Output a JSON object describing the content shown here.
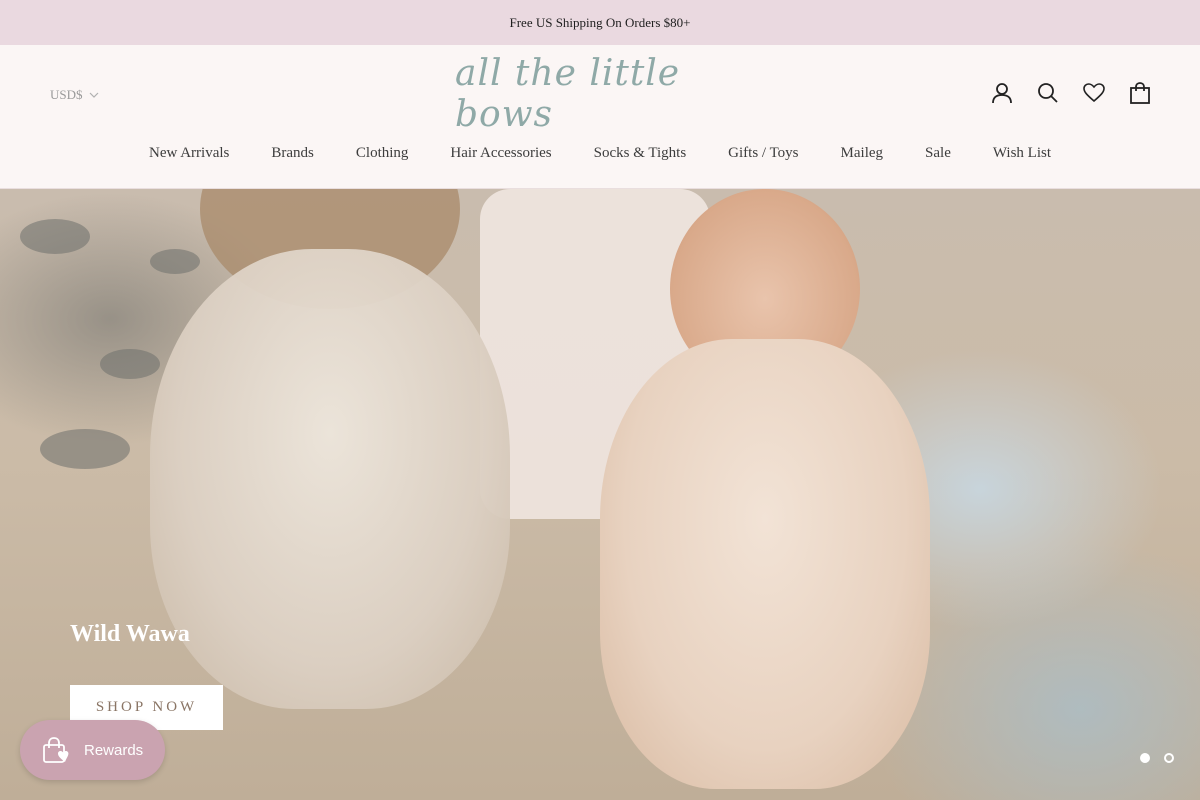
{
  "announcement": "Free US Shipping On Orders $80+",
  "header": {
    "currency": "USD$",
    "logo_text": "all the little bows",
    "icons": [
      "account-icon",
      "search-icon",
      "heart-icon",
      "bag-icon"
    ]
  },
  "nav": {
    "items": [
      {
        "label": "New Arrivals"
      },
      {
        "label": "Brands"
      },
      {
        "label": "Clothing"
      },
      {
        "label": "Hair Accessories"
      },
      {
        "label": "Socks & Tights"
      },
      {
        "label": "Gifts / Toys"
      },
      {
        "label": "Maileg"
      },
      {
        "label": "Sale"
      },
      {
        "label": "Wish List"
      }
    ]
  },
  "hero": {
    "title": "Wild Wawa",
    "button": "SHOP NOW",
    "slides_total": 2,
    "active_slide": 1
  },
  "rewards": {
    "label": "Rewards"
  },
  "colors": {
    "announcement_bg": "#ead9e0",
    "header_bg": "#fbf6f5",
    "logo": "#8fa9a7",
    "rewards_bg": "#caa3b0"
  }
}
